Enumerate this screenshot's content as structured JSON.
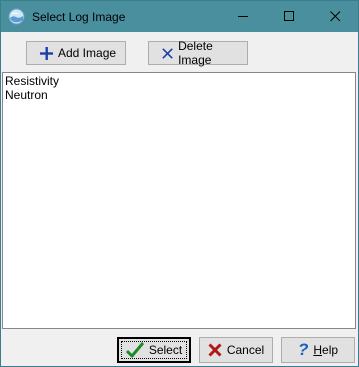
{
  "window": {
    "title": "Select Log Image"
  },
  "titlebar": {
    "icons": {
      "app": "globe-icon",
      "minimize": "minimize-icon",
      "maximize": "maximize-icon",
      "close": "close-icon"
    }
  },
  "toolbar": {
    "add_label": "Add Image",
    "delete_label": "Delete Image"
  },
  "list": {
    "items": [
      "Resistivity",
      "Neutron"
    ]
  },
  "footer": {
    "select_label": "Select",
    "cancel_label": "Cancel",
    "help_label": "Help",
    "help_mnemonic": "H"
  }
}
